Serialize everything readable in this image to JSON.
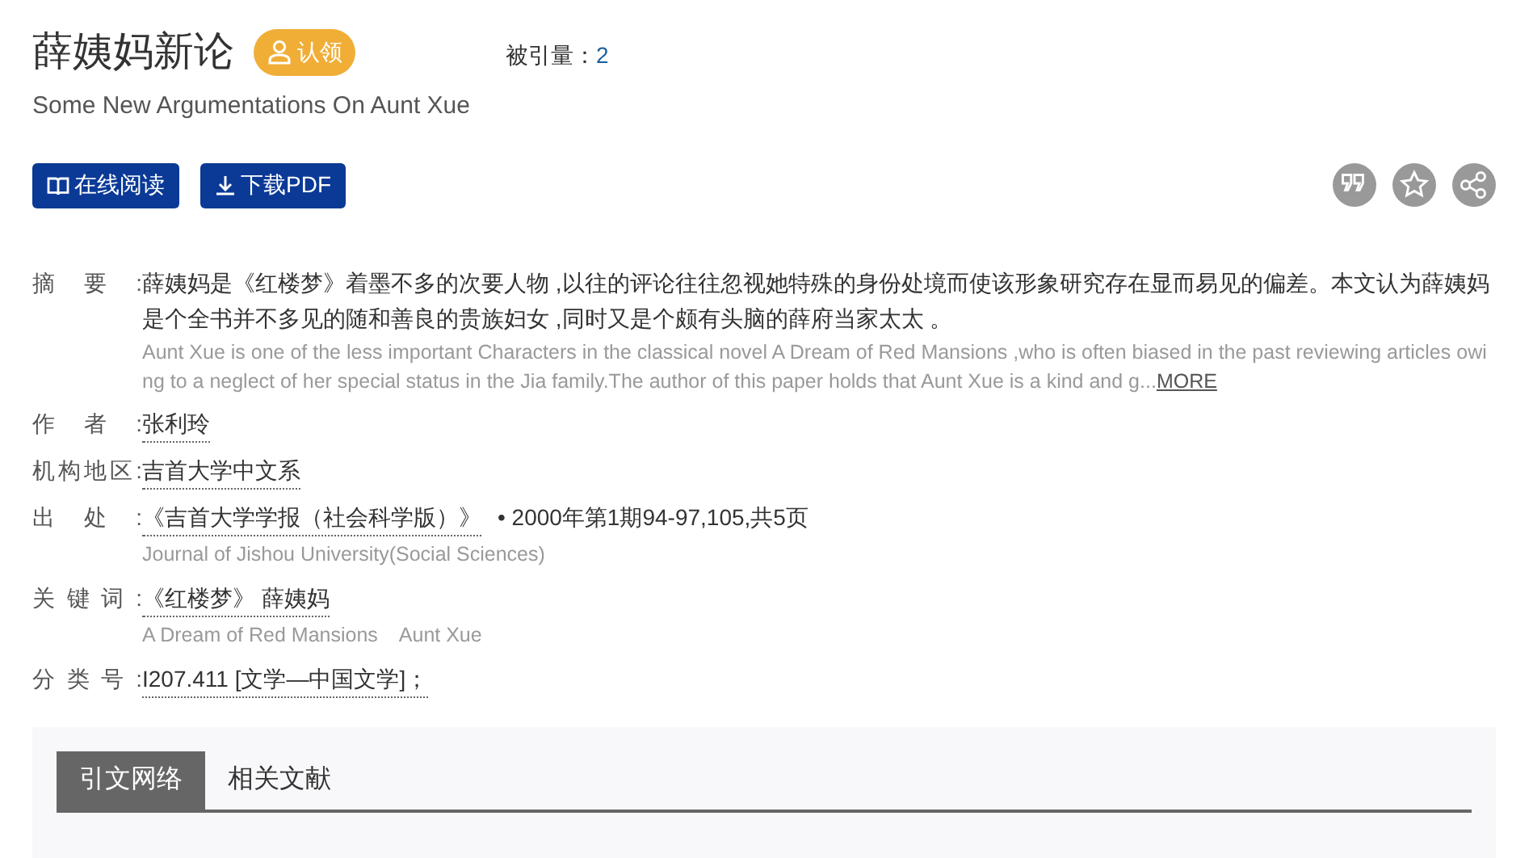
{
  "title": "薛姨妈新论",
  "claim_button": "认领",
  "citations": {
    "label": "被引量：",
    "value": "2"
  },
  "subtitle": "Some New Argumentations On Aunt Xue",
  "actions": [
    {
      "kind": "read",
      "label": "在线阅读"
    },
    {
      "kind": "download",
      "label": "下载PDF"
    }
  ],
  "tools": [
    {
      "kind": "quote"
    },
    {
      "kind": "star"
    },
    {
      "kind": "share"
    }
  ],
  "fields": [
    {
      "label": "摘要:",
      "kind": "abstract",
      "text": "薛姨妈是《红楼梦》着墨不多的次要人物 ,以往的评论往往忽视她特殊的身份处境而使该形象研究存在显而易见的偏差。本文认为薛姨妈是个全书并不多见的随和善良的贵族妇女 ,同时又是个颇有头脑的薛府当家太太 。",
      "english": "Aunt Xue is one of the less important Characters in the classical novel A Dream of Red Mansions ,who is often biased in the past reviewing articles owing to a neglect of her special status in the Jia family.The author of this paper holds that Aunt Xue is a kind and g...",
      "more": "MORE"
    },
    {
      "label": "作者:",
      "kind": "links",
      "links": [
        "张利玲"
      ]
    },
    {
      "label": "机构地区:",
      "kind": "links",
      "links": [
        "吉首大学中文系"
      ]
    },
    {
      "label": "出处:",
      "kind": "links",
      "links": [
        "《吉首大学学报（社会科学版）》"
      ],
      "extra": "• 2000年第1期94-97,105,共5页",
      "english": [
        "Journal of Jishou University(Social Sciences)"
      ]
    },
    {
      "label": "关键词:",
      "kind": "links",
      "links": [
        "《红楼梦》 薛姨妈"
      ],
      "english": [
        "A Dream of Red Mansions",
        "Aunt Xue"
      ]
    },
    {
      "label": "分类号:",
      "kind": "links",
      "links": [
        "I207.411 [文学—中国文学]；"
      ]
    }
  ],
  "tabs": [
    {
      "label": "引文网络",
      "selected": true
    },
    {
      "label": "相关文献",
      "selected": false
    }
  ]
}
